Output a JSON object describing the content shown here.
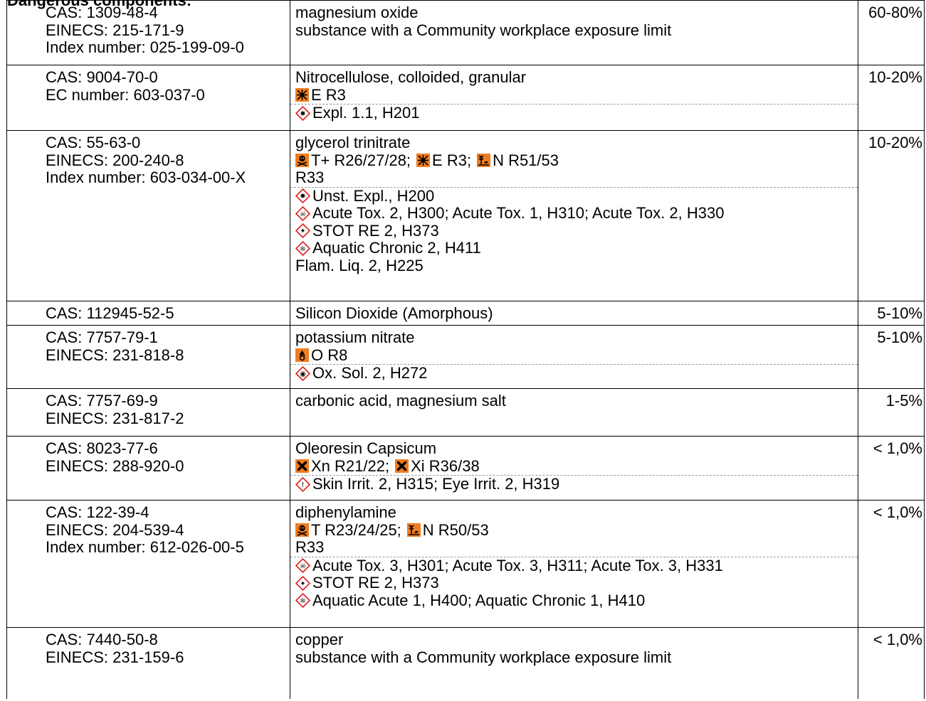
{
  "section_header": "Dangerous components:",
  "rows": [
    {
      "ids": [
        "CAS: 1309-48-4",
        "EINECS: 215-171-9",
        "Index number: 025-199-09-0"
      ],
      "name": "magnesium oxide",
      "note": "substance with a Community workplace exposure limit",
      "percent": "60-80%"
    },
    {
      "ids": [
        "CAS: 9004-70-0",
        "EC number: 603-037-0"
      ],
      "name": "Nitrocellulose, colloided, granular",
      "dsd": "E R3",
      "ghs": "Expl. 1.1, H201",
      "percent": "10-20%"
    },
    {
      "ids": [
        "CAS: 55-63-0",
        "EINECS: 200-240-8",
        "Index number: 603-034-00-X"
      ],
      "name": "glycerol trinitrate",
      "dsd": [
        "T+ R26/27/28;",
        "E R3;",
        "N R51/53"
      ],
      "dsd_extra": "R33",
      "ghs": [
        "Unst. Expl., H200",
        "Acute Tox. 2, H300; Acute Tox. 1, H310; Acute Tox. 2, H330",
        "STOT RE 2, H373",
        "Aquatic Chronic 2, H411"
      ],
      "ghs_extra": "Flam. Liq. 2, H225",
      "percent": "10-20%"
    },
    {
      "ids": [
        "CAS: 112945-52-5"
      ],
      "name": "Silicon Dioxide (Amorphous)",
      "percent": "5-10%"
    },
    {
      "ids": [
        "CAS: 7757-79-1",
        "EINECS: 231-818-8"
      ],
      "name": "potassium nitrate",
      "dsd": "O R8",
      "ghs": "Ox. Sol. 2, H272",
      "percent": "5-10%"
    },
    {
      "ids": [
        "CAS: 7757-69-9",
        "EINECS: 231-817-2"
      ],
      "name": "carbonic acid, magnesium salt",
      "percent": "1-5%"
    },
    {
      "ids": [
        "CAS: 8023-77-6",
        "EINECS: 288-920-0"
      ],
      "name": "Oleoresin Capsicum",
      "dsd": [
        "Xn R21/22;",
        "Xi R36/38"
      ],
      "ghs": "Skin Irrit. 2, H315; Eye Irrit. 2, H319",
      "percent": "< 1,0%"
    },
    {
      "ids": [
        "CAS: 122-39-4",
        "EINECS: 204-539-4",
        "Index number: 612-026-00-5"
      ],
      "name": "diphenylamine",
      "dsd": [
        "T R23/24/25;",
        "N R50/53"
      ],
      "dsd_extra": "R33",
      "ghs": [
        "Acute Tox. 3, H301; Acute Tox. 3, H311; Acute Tox. 3, H331",
        "STOT RE 2, H373",
        "Aquatic Acute 1, H400; Aquatic Chronic 1, H410"
      ],
      "percent": "< 1,0%"
    },
    {
      "ids": [
        "CAS: 7440-50-8",
        "EINECS: 231-159-6"
      ],
      "name": "copper",
      "note": "substance with a Community workplace exposure limit",
      "percent": "< 1,0%"
    }
  ],
  "colors": {
    "hazard_orange": "#f07c1e",
    "ghs_red": "#e0201b",
    "border": "#000000",
    "dash": "#999999"
  }
}
